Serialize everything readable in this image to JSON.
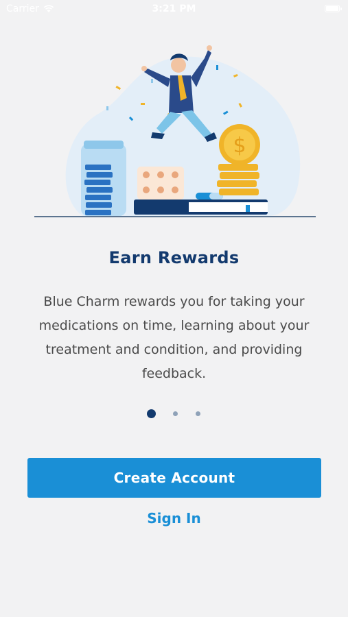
{
  "status_bar": {
    "carrier": "Carrier",
    "time": "3:21 PM",
    "icons": [
      "wifi-icon",
      "battery-icon"
    ]
  },
  "onboarding": {
    "title": "Earn Rewards",
    "description": "Blue Charm rewards you for taking your medications on time, learning about your treatment and condition, and providing feedback.",
    "page_indicator": {
      "current": 1,
      "total": 3
    }
  },
  "actions": {
    "create_account_label": "Create Account",
    "sign_in_label": "Sign In"
  },
  "colors": {
    "background": "#f2f2f3",
    "title": "#133a6e",
    "primary": "#1a8fd6",
    "dot_active": "#133a6e",
    "dot_inactive": "#8fa2b8"
  }
}
